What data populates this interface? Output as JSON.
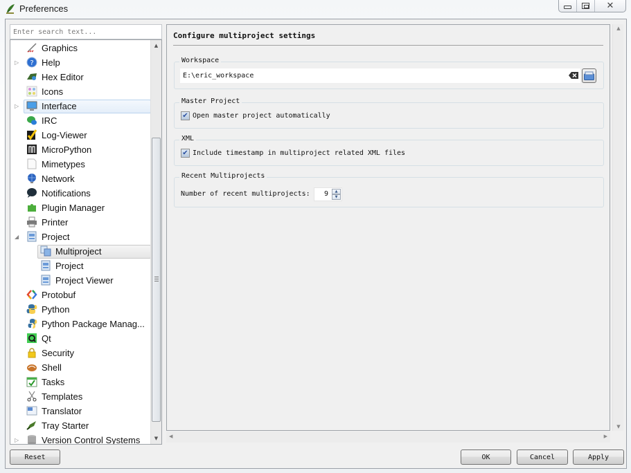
{
  "window": {
    "title": "Preferences",
    "controls": {
      "minimize": "minimize",
      "maximize": "maximize",
      "close": "close"
    }
  },
  "sidebar": {
    "search_placeholder": "Enter search text...",
    "search_value": "",
    "items": [
      {
        "label": "Graphics",
        "icon": "graphics-icon",
        "level": 0,
        "expander": ""
      },
      {
        "label": "Help",
        "icon": "help-icon",
        "level": 0,
        "expander": "collapsed"
      },
      {
        "label": "Hex Editor",
        "icon": "hex-editor-icon",
        "level": 0,
        "expander": ""
      },
      {
        "label": "Icons",
        "icon": "icons-icon",
        "level": 0,
        "expander": ""
      },
      {
        "label": "Interface",
        "icon": "monitor-icon",
        "level": 0,
        "expander": "collapsed",
        "hover": true
      },
      {
        "label": "IRC",
        "icon": "irc-icon",
        "level": 0,
        "expander": ""
      },
      {
        "label": "Log-Viewer",
        "icon": "log-viewer-icon",
        "level": 0,
        "expander": ""
      },
      {
        "label": "MicroPython",
        "icon": "micropython-icon",
        "level": 0,
        "expander": ""
      },
      {
        "label": "Mimetypes",
        "icon": "mimetypes-icon",
        "level": 0,
        "expander": ""
      },
      {
        "label": "Network",
        "icon": "network-globe-icon",
        "level": 0,
        "expander": ""
      },
      {
        "label": "Notifications",
        "icon": "notifications-icon",
        "level": 0,
        "expander": ""
      },
      {
        "label": "Plugin Manager",
        "icon": "plugin-puzzle-icon",
        "level": 0,
        "expander": ""
      },
      {
        "label": "Printer",
        "icon": "printer-icon",
        "level": 0,
        "expander": ""
      },
      {
        "label": "Project",
        "icon": "project-icon",
        "level": 0,
        "expander": "expanded"
      },
      {
        "label": "Multiproject",
        "icon": "multiproject-icon",
        "level": 1,
        "expander": "",
        "selected": true
      },
      {
        "label": "Project",
        "icon": "project-icon",
        "level": 1,
        "expander": ""
      },
      {
        "label": "Project Viewer",
        "icon": "project-icon",
        "level": 1,
        "expander": ""
      },
      {
        "label": "Protobuf",
        "icon": "protobuf-icon",
        "level": 0,
        "expander": ""
      },
      {
        "label": "Python",
        "icon": "python-icon",
        "level": 0,
        "expander": ""
      },
      {
        "label": "Python Package Manag...",
        "icon": "python-package-icon",
        "level": 0,
        "expander": ""
      },
      {
        "label": "Qt",
        "icon": "qt-icon",
        "level": 0,
        "expander": ""
      },
      {
        "label": "Security",
        "icon": "lock-icon",
        "level": 0,
        "expander": ""
      },
      {
        "label": "Shell",
        "icon": "shell-icon",
        "level": 0,
        "expander": ""
      },
      {
        "label": "Tasks",
        "icon": "tasks-check-icon",
        "level": 0,
        "expander": ""
      },
      {
        "label": "Templates",
        "icon": "scissors-icon",
        "level": 0,
        "expander": ""
      },
      {
        "label": "Translator",
        "icon": "translator-icon",
        "level": 0,
        "expander": ""
      },
      {
        "label": "Tray Starter",
        "icon": "tray-starter-icon",
        "level": 0,
        "expander": ""
      },
      {
        "label": "Version Control Systems",
        "icon": "vcs-database-icon",
        "level": 0,
        "expander": "collapsed"
      }
    ],
    "reset_label": "Reset"
  },
  "page": {
    "title": "Configure multiproject settings",
    "workspace": {
      "group_title": "Workspace",
      "path_value": "E:\\eric_workspace"
    },
    "master_project": {
      "group_title": "Master Project",
      "checkbox_label": "Open master project automatically",
      "checked": true
    },
    "xml": {
      "group_title": "XML",
      "checkbox_label": "Include timestamp in multiproject related XML files",
      "checked": true
    },
    "recent": {
      "group_title": "Recent Multiprojects",
      "spin_label": "Number of recent multiprojects:",
      "spin_value": "9"
    }
  },
  "buttons": {
    "ok": "OK",
    "cancel": "Cancel",
    "apply": "Apply"
  },
  "colors": {
    "hover_border": "#b9d3ee",
    "dialog_bg": "#f0f0f0",
    "group_border": "#d5dfe5"
  }
}
